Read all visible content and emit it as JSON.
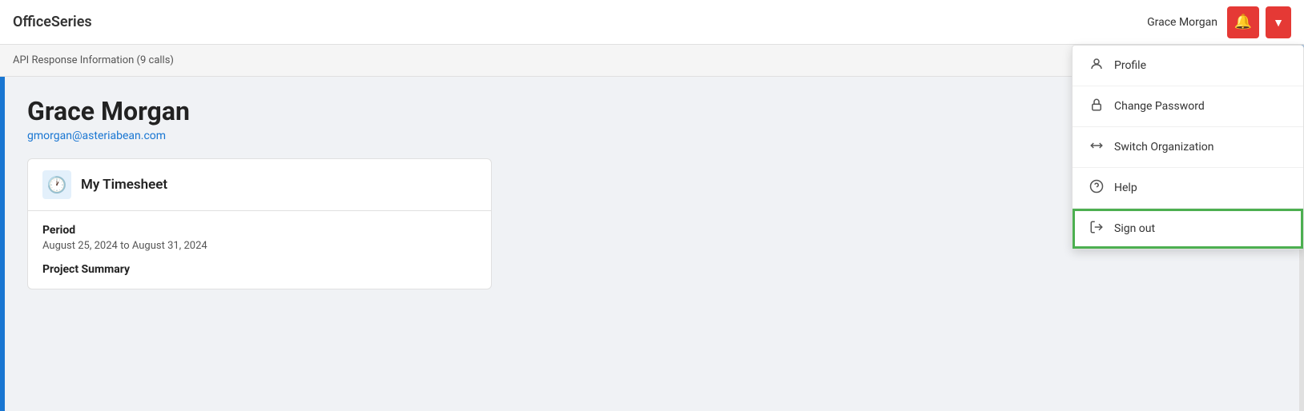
{
  "header": {
    "logo": "OfficeSeries",
    "username": "Grace Morgan",
    "bell_label": "🔔",
    "dropdown_arrow": "▼"
  },
  "subheader": {
    "text": "API Response Information (9 calls)"
  },
  "profile": {
    "name": "Grace Morgan",
    "email": "gmorgan@asteriabean.com"
  },
  "timesheet": {
    "title": "My Timesheet",
    "icon": "🕐",
    "period_label": "Period",
    "period_dates": "August 25, 2024 to August 31, 2024",
    "project_summary_label": "Project Summary"
  },
  "dropdown": {
    "items": [
      {
        "id": "profile",
        "label": "Profile",
        "icon": "👤"
      },
      {
        "id": "change-password",
        "label": "Change Password",
        "icon": "🔒"
      },
      {
        "id": "switch-org",
        "label": "Switch Organization",
        "icon": "⇄"
      },
      {
        "id": "help",
        "label": "Help",
        "icon": "❓"
      },
      {
        "id": "sign-out",
        "label": "Sign out",
        "icon": "→",
        "active": true
      }
    ]
  }
}
